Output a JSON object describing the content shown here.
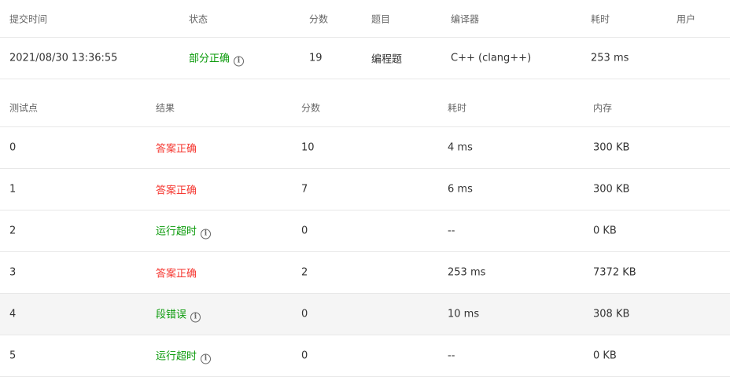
{
  "submission": {
    "headers": [
      "提交时间",
      "状态",
      "分数",
      "题目",
      "编译器",
      "耗时",
      "用户"
    ],
    "row": {
      "time": "2021/08/30 13:36:55",
      "status": "部分正确",
      "score": "19",
      "problem": "编程题",
      "compiler": "C++ (clang++)",
      "elapsed": "253 ms",
      "user": ""
    }
  },
  "tests": {
    "headers": [
      "测试点",
      "结果",
      "分数",
      "耗时",
      "内存"
    ],
    "rows": [
      {
        "id": "0",
        "result": "答案正确",
        "score": "10",
        "time": "4 ms",
        "memory": "300 KB"
      },
      {
        "id": "1",
        "result": "答案正确",
        "score": "7",
        "time": "6 ms",
        "memory": "300 KB"
      },
      {
        "id": "2",
        "result": "运行超时",
        "score": "0",
        "time": "--",
        "memory": "0 KB"
      },
      {
        "id": "3",
        "result": "答案正确",
        "score": "2",
        "time": "253 ms",
        "memory": "7372 KB"
      },
      {
        "id": "4",
        "result": "段错误",
        "score": "0",
        "time": "10 ms",
        "memory": "308 KB"
      },
      {
        "id": "5",
        "result": "运行超时",
        "score": "0",
        "time": "--",
        "memory": "0 KB"
      }
    ]
  },
  "colors": {
    "accepted": "#f5362f",
    "error": "#0a9a0a"
  }
}
